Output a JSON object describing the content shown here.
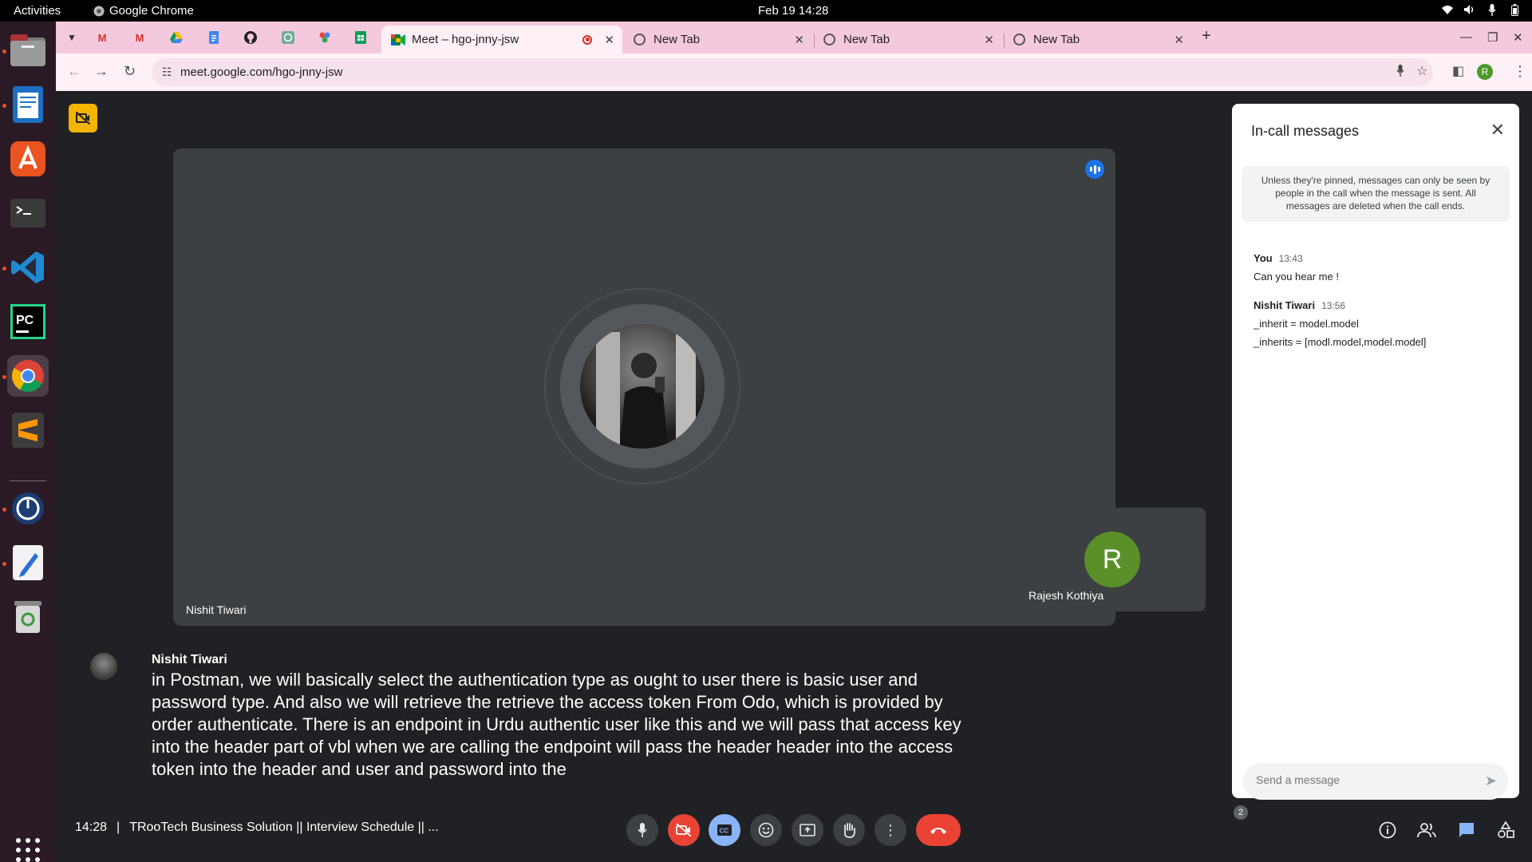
{
  "topbar": {
    "activities": "Activities",
    "app_name": "Google Chrome",
    "clock": "Feb 19  14:28",
    "tray_icons": [
      "wifi-icon",
      "volume-icon",
      "mic-icon",
      "battery-icon"
    ]
  },
  "dock": {
    "apps": [
      "files",
      "writer",
      "app-center",
      "terminal",
      "vscode",
      "pycharm",
      "chrome",
      "sublime-text",
      "timer",
      "text-editor",
      "trash"
    ],
    "show_apps": "show-apps-icon"
  },
  "chrome": {
    "pinned_tabs": [
      "gmail",
      "gmail",
      "drive",
      "docs",
      "github",
      "chatgpt",
      "app",
      "sheets"
    ],
    "tabs": [
      {
        "title": "Meet – hgo-jnny-jsw",
        "active": true,
        "recording": true
      },
      {
        "title": "New Tab",
        "active": false
      },
      {
        "title": "New Tab",
        "active": false
      },
      {
        "title": "New Tab",
        "active": false
      }
    ],
    "new_tab": "+",
    "url": "meet.google.com/hgo-jnny-jsw",
    "profile_initial": "R"
  },
  "meet": {
    "main_participant": "Nishit Tiwari",
    "self_participant": "Rajesh Kothiya",
    "self_initial": "R",
    "caption": {
      "speaker": "Nishit Tiwari",
      "text": "in Postman, we will basically select the authentication type as ought to user there is basic user and password type. And also we will retrieve the retrieve the access token From Odo, which is provided by order authenticate. There is an endpoint in Urdu authentic user like this and we will pass that access key into the header part of vbl when we are calling the endpoint will pass the header header into the access token into the header and user and password into the"
    },
    "time": "14:28",
    "separator": "|",
    "meeting_title": "TRooTech Business Solution || Interview Schedule || ...",
    "people_count": "2",
    "colors": {
      "end_call": "#ea4335",
      "active_control": "#8ab4f8",
      "host_badge": "#f4b400"
    }
  },
  "chat": {
    "title": "In-call messages",
    "notice": "Unless they're pinned, messages can only be seen by people in the call when the message is sent. All messages are deleted when the call ends.",
    "messages": [
      {
        "sender": "You",
        "time": "13:43",
        "lines": [
          "Can you hear me !"
        ]
      },
      {
        "sender": "Nishit Tiwari",
        "time": "13:56",
        "lines": [
          "_inherit = model.model",
          "_inherits = [modl.model,model.model]"
        ]
      }
    ],
    "placeholder": "Send a message"
  }
}
